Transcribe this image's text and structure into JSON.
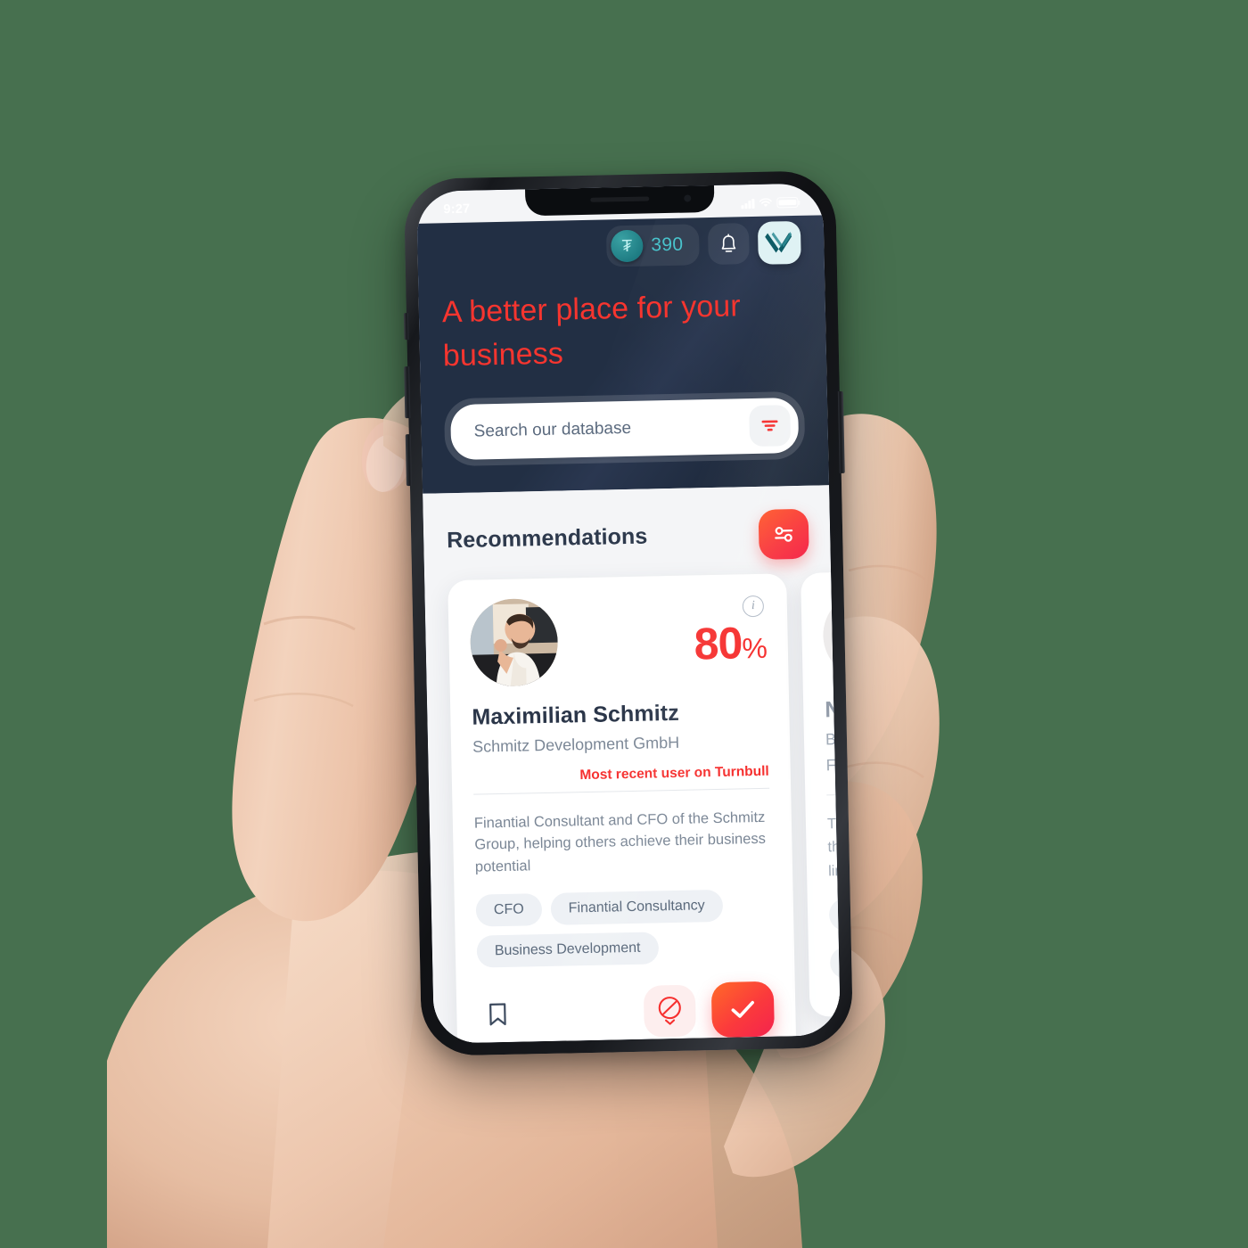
{
  "theme": {
    "background": "#47704f",
    "header_bg": "#222f44",
    "accent_red": "#f6302f",
    "accent_teal": "#49c3cc",
    "card_bg": "#ffffff",
    "body_bg": "#f4f5f7"
  },
  "status_bar": {
    "time": "9:27",
    "cellular_icon": "signal-bars-icon",
    "wifi_icon": "wifi-icon",
    "battery_icon": "battery-icon"
  },
  "header": {
    "coin": {
      "symbol": "₮",
      "amount": "390",
      "icon": "coin-icon"
    },
    "notifications_icon": "bell-icon",
    "logo_icon": "chevron-v-logo-icon",
    "headline": "A better place for your business",
    "search": {
      "placeholder": "Search our database",
      "value": "",
      "filter_icon": "filter-funnel-icon"
    }
  },
  "main": {
    "section_title": "Recommendations",
    "tune_button_icon": "sliders-icon",
    "cards": [
      {
        "avatar_alt": "man-on-phone-photo",
        "info_icon": "info-icon",
        "match_value": "80",
        "match_unit": "%",
        "name": "Maximilian Schmitz",
        "company": "Schmitz Development GmbH",
        "badge": "Most recent user on Turnbull",
        "bio": "Finantial Consultant and CFO of the Schmitz Group, helping others achieve their business potential",
        "tags": [
          "CFO",
          "Finantial Consultancy",
          "Business Development"
        ],
        "actions": {
          "bookmark_icon": "bookmark-icon",
          "reject_icon": "reject-circle-icon",
          "accept_icon": "check-icon"
        }
      },
      {
        "avatar_alt": "person-photo",
        "name": "N",
        "company_line_1": "Ba",
        "company_line_2": "Fu",
        "bio_line_1": "Th",
        "bio_line_2": "the",
        "bio_line_3": "lin"
      }
    ]
  }
}
